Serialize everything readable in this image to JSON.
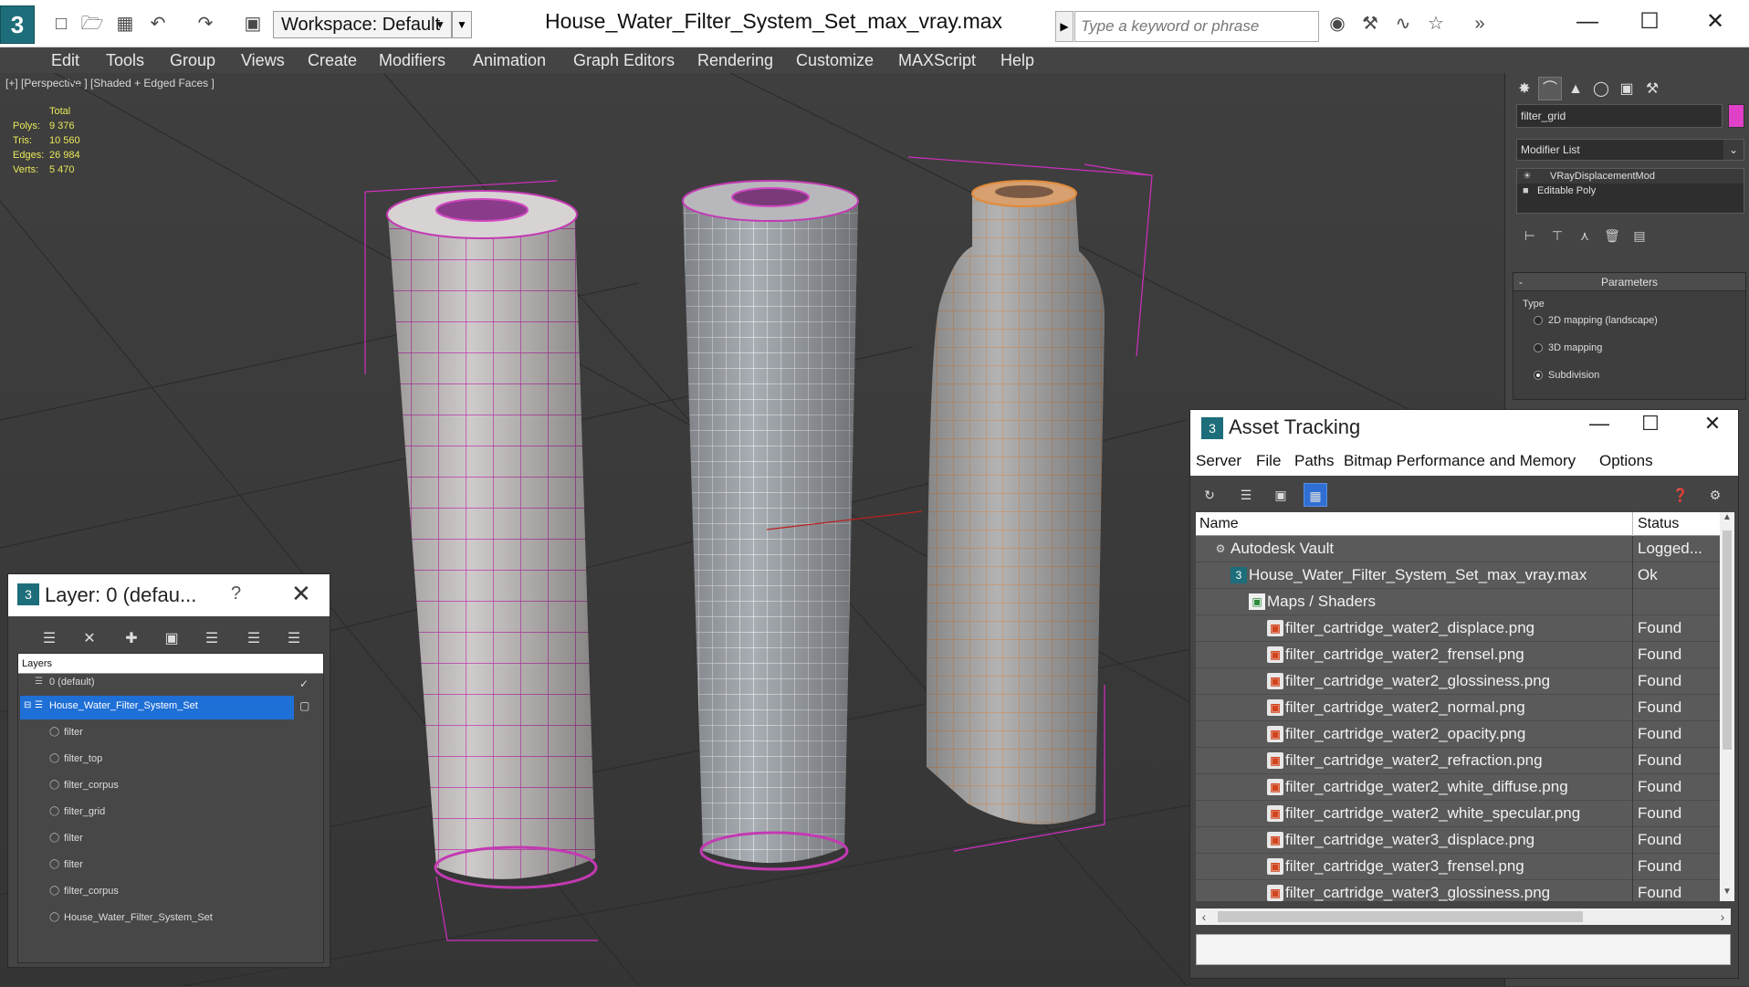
{
  "window": {
    "title": "House_Water_Filter_System_Set_max_vray.max",
    "workspace": "Workspace: Default",
    "search_placeholder": "Type a keyword or phrase"
  },
  "menu": [
    "Edit",
    "Tools",
    "Group",
    "Views",
    "Create",
    "Modifiers",
    "Animation",
    "Graph Editors",
    "Rendering",
    "Customize",
    "MAXScript",
    "Help"
  ],
  "viewport": {
    "label": "[+] [Perspective ] [Shaded + Edged Faces ]",
    "stats": {
      "header": "Total",
      "rows": [
        {
          "label": "Polys:",
          "value": "9 376"
        },
        {
          "label": "Tris:",
          "value": "10 560"
        },
        {
          "label": "Edges:",
          "value": "26 984"
        },
        {
          "label": "Verts:",
          "value": "5 470"
        }
      ]
    }
  },
  "command_panel": {
    "object_name": "filter_grid",
    "modifier_list": "Modifier List",
    "stack": [
      "VRayDisplacementMod",
      "Editable Poly"
    ],
    "params_title": "Parameters",
    "type_label": "Type",
    "options": [
      {
        "label": "2D mapping (landscape)",
        "selected": false
      },
      {
        "label": "3D mapping",
        "selected": false
      },
      {
        "label": "Subdivision",
        "selected": true
      }
    ],
    "accent": "#e040c8"
  },
  "layer_panel": {
    "title": "Layer: 0 (defau...",
    "help": "?",
    "header": "Layers",
    "rows": [
      {
        "label": "0 (default)",
        "indent": 0,
        "selected": false
      },
      {
        "label": "House_Water_Filter_System_Set",
        "indent": 0,
        "selected": true
      },
      {
        "label": "filter",
        "indent": 1
      },
      {
        "label": "filter_top",
        "indent": 1
      },
      {
        "label": "filter_corpus",
        "indent": 1
      },
      {
        "label": "filter_grid",
        "indent": 1
      },
      {
        "label": "filter",
        "indent": 1
      },
      {
        "label": "filter",
        "indent": 1
      },
      {
        "label": "filter_corpus",
        "indent": 1
      },
      {
        "label": "House_Water_Filter_System_Set",
        "indent": 1
      }
    ]
  },
  "asset_tracking": {
    "title": "Asset Tracking",
    "menu": [
      "Server",
      "File",
      "Paths",
      "Bitmap Performance and Memory",
      "Options"
    ],
    "col_name": "Name",
    "col_status": "Status",
    "rows": [
      {
        "name": "Autodesk Vault",
        "status": "Logged...",
        "level": 0,
        "icon": "vault"
      },
      {
        "name": "House_Water_Filter_System_Set_max_vray.max",
        "status": "Ok",
        "level": 1,
        "icon": "max"
      },
      {
        "name": "Maps / Shaders",
        "status": "",
        "level": 2,
        "icon": "maps"
      },
      {
        "name": "filter_cartridge_water2_displace.png",
        "status": "Found",
        "level": 3,
        "icon": "png"
      },
      {
        "name": "filter_cartridge_water2_frensel.png",
        "status": "Found",
        "level": 3,
        "icon": "png"
      },
      {
        "name": "filter_cartridge_water2_glossiness.png",
        "status": "Found",
        "level": 3,
        "icon": "png"
      },
      {
        "name": "filter_cartridge_water2_normal.png",
        "status": "Found",
        "level": 3,
        "icon": "png"
      },
      {
        "name": "filter_cartridge_water2_opacity.png",
        "status": "Found",
        "level": 3,
        "icon": "png"
      },
      {
        "name": "filter_cartridge_water2_refraction.png",
        "status": "Found",
        "level": 3,
        "icon": "png"
      },
      {
        "name": "filter_cartridge_water2_white_diffuse.png",
        "status": "Found",
        "level": 3,
        "icon": "png"
      },
      {
        "name": "filter_cartridge_water2_white_specular.png",
        "status": "Found",
        "level": 3,
        "icon": "png"
      },
      {
        "name": "filter_cartridge_water3_displace.png",
        "status": "Found",
        "level": 3,
        "icon": "png"
      },
      {
        "name": "filter_cartridge_water3_frensel.png",
        "status": "Found",
        "level": 3,
        "icon": "png"
      },
      {
        "name": "filter_cartridge_water3_glossiness.png",
        "status": "Found",
        "level": 3,
        "icon": "png"
      }
    ]
  }
}
